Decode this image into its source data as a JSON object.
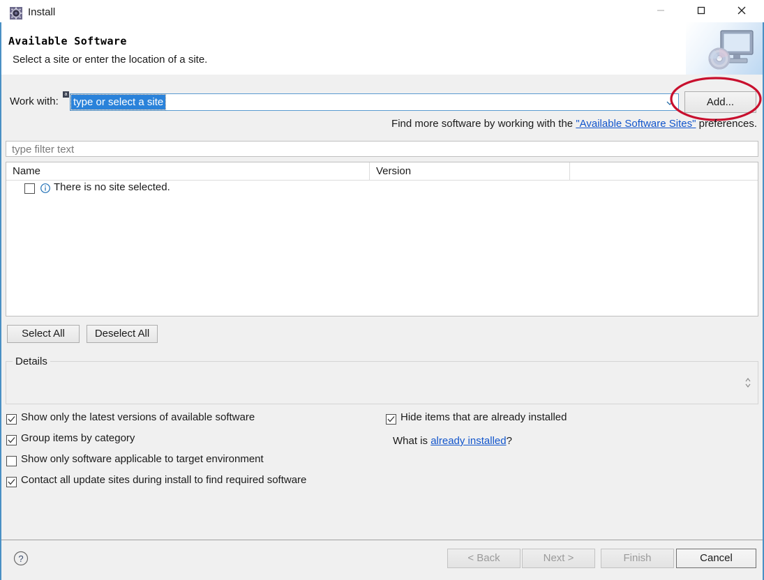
{
  "window": {
    "title": "Install",
    "icon": "eclipse-install-icon",
    "controls": {
      "minimize": "minimize-icon",
      "maximize": "maximize-icon",
      "close": "close-icon"
    }
  },
  "header": {
    "title": "Available Software",
    "subtitle": "Select a site or enter the location of a site.",
    "banner_icon": "computer-disc-icon"
  },
  "work_with": {
    "label": "Work with:",
    "assist_badge": "a",
    "value": "type or select a site",
    "dropdown_icon": "chevron-down-icon",
    "add_button": "Add..."
  },
  "annotation": {
    "shape": "ellipse",
    "color": "#c8102e",
    "target": "add-button"
  },
  "find_more": {
    "prefix": "Find more software by working with the ",
    "link": "\"Available Software Sites\"",
    "suffix": " preferences."
  },
  "filter": {
    "placeholder": "type filter text",
    "value": ""
  },
  "table": {
    "columns": [
      "Name",
      "Version",
      ""
    ],
    "rows": [
      {
        "checked": false,
        "icon": "info-icon",
        "name": "There is no site selected.",
        "version": ""
      }
    ]
  },
  "selection_buttons": {
    "select_all": "Select All",
    "deselect_all": "Deselect All"
  },
  "details": {
    "label": "Details",
    "content": "",
    "spinner_icon": "up-down-spinner-icon"
  },
  "options": [
    {
      "label": "Show only the latest versions of available software",
      "checked": true
    },
    {
      "label": "Group items by category",
      "checked": true
    },
    {
      "label": "Show only software applicable to target environment",
      "checked": false
    },
    {
      "label": "Contact all update sites during install to find required software",
      "checked": true
    },
    {
      "label": "Hide items that are already installed",
      "checked": true
    }
  ],
  "what_is": {
    "prefix": "What is ",
    "link": "already installed",
    "suffix": "?"
  },
  "footer": {
    "help_icon": "help-question-icon",
    "back": "< Back",
    "next": "Next >",
    "finish": "Finish",
    "cancel": "Cancel"
  },
  "colors": {
    "selection_blue": "#2a82da",
    "link_blue": "#1155cc",
    "annotation_red": "#c8102e",
    "dialog_bg": "#f0f0f0"
  }
}
